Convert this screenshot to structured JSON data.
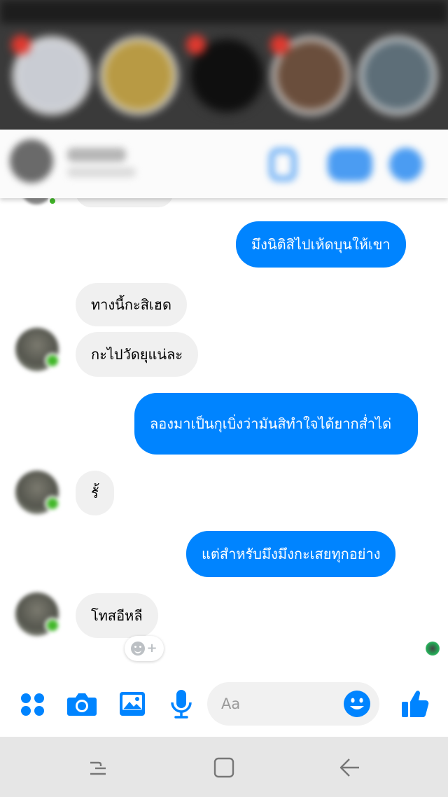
{
  "colors": {
    "accent": "#0084ff",
    "incoming_bubble": "#f0f0f0",
    "outgoing_bubble": "#0084ff",
    "online": "#42b72a",
    "story_badge": "#e0392f",
    "nav_bar": "#e6e6e6"
  },
  "messages": [
    {
      "direction": "outgoing",
      "text": "มึงนิติสิไปเห้ดบุนให้เขา"
    },
    {
      "direction": "incoming",
      "text": "ทางนี้กะสิเฮด"
    },
    {
      "direction": "incoming",
      "text": "กะไปวัดยุแน่ละ"
    },
    {
      "direction": "outgoing",
      "text": "ลองมาเป็นกุเบิ่งว่ามันสิทำใจได้ยากส่ำได่"
    },
    {
      "direction": "incoming",
      "text": "รั้"
    },
    {
      "direction": "outgoing",
      "text": "แต่สำหรับมึงมึงกะเสยทุกอย่าง"
    },
    {
      "direction": "incoming",
      "text": "โทสอีหลี"
    }
  ],
  "composer": {
    "placeholder": "Aa",
    "icons": [
      "apps-grid-icon",
      "camera-icon",
      "image-icon",
      "microphone-icon",
      "emoji-icon",
      "thumbs-up-icon"
    ]
  },
  "reaction_button": {
    "icons": [
      "smiley-icon",
      "plus-icon"
    ]
  },
  "navbar": {
    "icons": [
      "recent-apps-icon",
      "home-icon",
      "back-icon"
    ]
  }
}
